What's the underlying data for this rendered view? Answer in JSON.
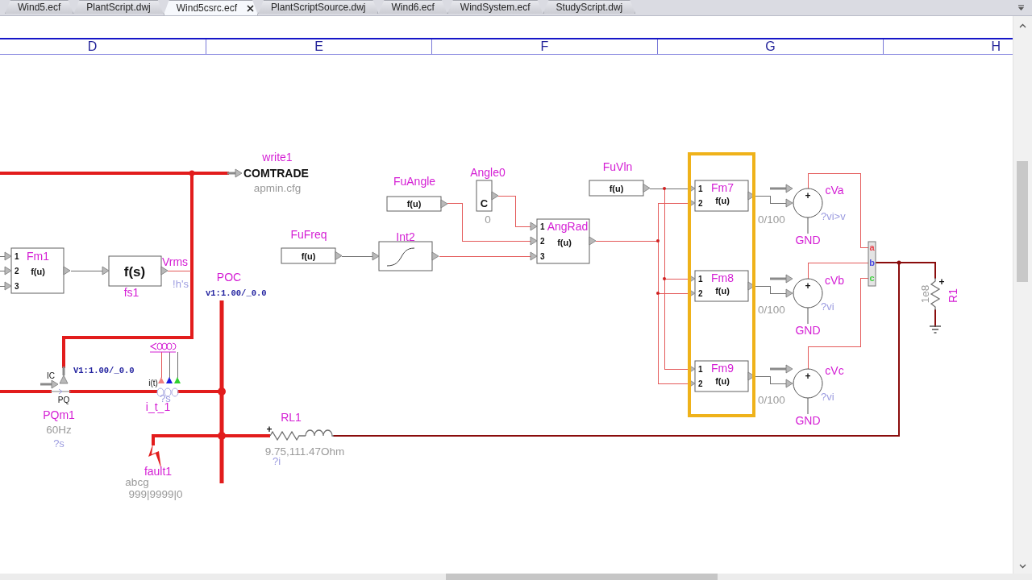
{
  "tabs": [
    {
      "label": "Wind5.ecf",
      "selected": false
    },
    {
      "label": "PlantScript.dwj",
      "selected": false
    },
    {
      "label": "Wind5csrc.ecf",
      "selected": true
    },
    {
      "label": "PlantScriptSource.dwj",
      "selected": false
    },
    {
      "label": "Wind6.ecf",
      "selected": false
    },
    {
      "label": "WindSystem.ecf",
      "selected": false
    },
    {
      "label": "StudyScript.dwj",
      "selected": false
    }
  ],
  "column_headers": [
    "D",
    "E",
    "F",
    "G",
    "H"
  ],
  "schematic": {
    "components": [
      {
        "kind": "recorder",
        "name": "write1",
        "title": "COMTRADE",
        "file": "apmin.cfg",
        "selected": false
      },
      {
        "kind": "function",
        "name": "FuAngle",
        "expression": "f(u)",
        "selected": false
      },
      {
        "kind": "constant",
        "name": "Angle0",
        "symbol": "C",
        "value": "0",
        "selected": false
      },
      {
        "kind": "function",
        "name": "FuVln",
        "expression": "f(u)",
        "selected": false
      },
      {
        "kind": "multi_function",
        "name": "Fm7",
        "expression": "f(u)",
        "inputs": [
          "1",
          "2"
        ],
        "selected": true
      },
      {
        "kind": "multi_function",
        "name": "Fm1",
        "expression": "f(u)",
        "inputs": [
          "1",
          "2",
          "3"
        ],
        "selected": false
      },
      {
        "kind": "transfer_function",
        "name": "fs1",
        "expression": "f(s)",
        "output": "Vrms",
        "status": "!h's",
        "selected": false
      },
      {
        "kind": "function",
        "name": "FuFreq",
        "expression": "f(u)",
        "selected": false
      },
      {
        "kind": "integrator",
        "name": "Int2",
        "selected": false
      },
      {
        "kind": "multi_function",
        "name": "AngRad",
        "expression": "f(u)",
        "inputs": [
          "1",
          "2",
          "3"
        ],
        "selected": false
      },
      {
        "kind": "voltage_source",
        "name": "cVa",
        "polarity": "+",
        "scale": "0/100",
        "status": "?vi>v",
        "ground": "GND",
        "selected": false
      },
      {
        "kind": "pq_meter",
        "name": "PQm1",
        "control": "IC",
        "port": "PQ",
        "reading": "V1:1.00/_0.0",
        "frequency": "60Hz",
        "status": "?s",
        "selected": false
      },
      {
        "kind": "current_meter",
        "name": "i_t_1",
        "signal": "i(t)",
        "status": "?s",
        "selected": false
      },
      {
        "kind": "fault",
        "name": "fault1",
        "fault_type": "abcg",
        "timing": "999|9999|0",
        "selected": false
      },
      {
        "kind": "bus",
        "name": "POC",
        "reading": "v1:1.00/_0.0",
        "selected": false
      },
      {
        "kind": "rl_branch",
        "name": "RL1",
        "polarity": "+",
        "value": "9.75,111.47Ohm",
        "status": "?i",
        "selected": false
      },
      {
        "kind": "multi_function",
        "name": "Fm8",
        "expression": "f(u)",
        "inputs": [
          "1",
          "2"
        ],
        "selected": true
      },
      {
        "kind": "voltage_source",
        "name": "cVb",
        "polarity": "+",
        "scale": "0/100",
        "status": "?vi",
        "ground": "GND",
        "selected": false
      },
      {
        "kind": "phase_bus",
        "phases": [
          {
            "label": "a",
            "color": "#e8404a"
          },
          {
            "label": "b",
            "color": "#4848e0"
          },
          {
            "label": "c",
            "color": "#40d040"
          }
        ],
        "selected": false
      },
      {
        "kind": "resistor",
        "name": "R1",
        "polarity": "+",
        "value": "1e8",
        "selected": false
      },
      {
        "kind": "multi_function",
        "name": "Fm9",
        "expression": "f(u)",
        "inputs": [
          "1",
          "2"
        ],
        "selected": true
      },
      {
        "kind": "voltage_source",
        "name": "cVc",
        "polarity": "+",
        "scale": "0/100",
        "status": "?vi",
        "ground": "GND",
        "selected": false
      }
    ]
  }
}
